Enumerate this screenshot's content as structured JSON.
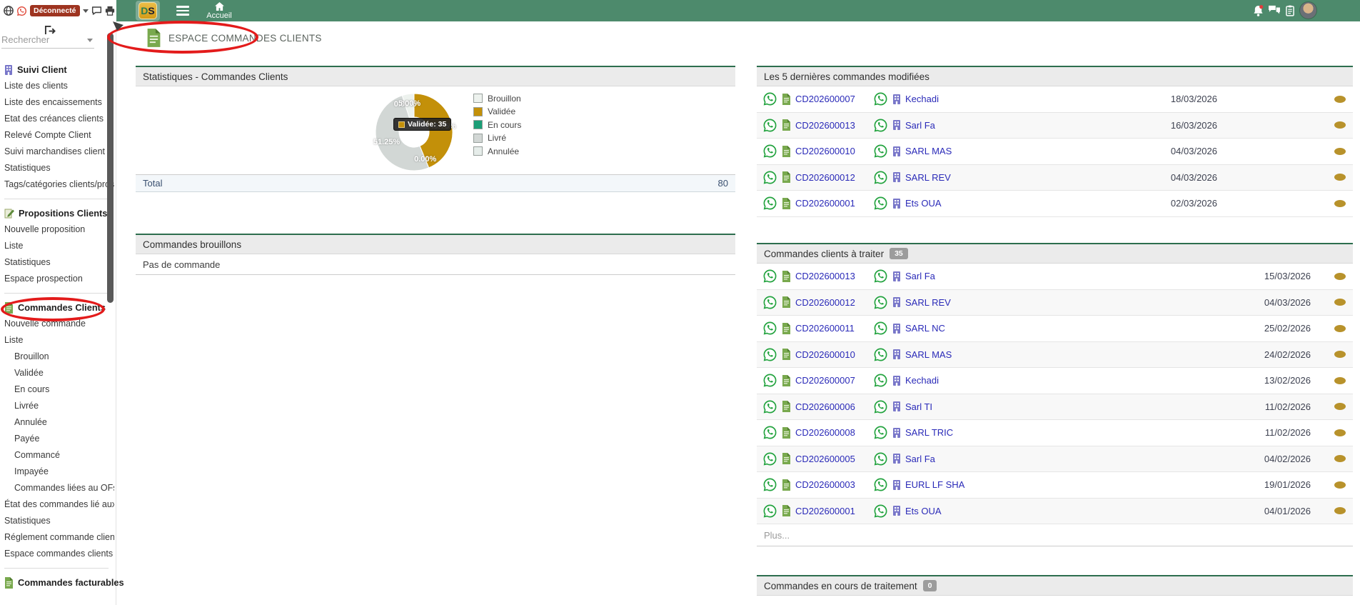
{
  "topbar": {
    "logo_text_d": "D",
    "logo_text_s": "S",
    "accueil_label": "Accueil",
    "right_icons": [
      "bell-icon",
      "chat-bubbles-icon",
      "clipboard-icon",
      "avatar"
    ]
  },
  "quickbar": {
    "icons": [
      "globe-icon",
      "whatsapp-icon",
      "comment-icon",
      "printer-icon",
      "help-icon"
    ],
    "status_label": "Déconnecté"
  },
  "sidebar": {
    "search_placeholder": "Rechercher",
    "sections": [
      {
        "title": "Suivi Client",
        "icon": "building-icon",
        "items": [
          {
            "label": "Liste des clients"
          },
          {
            "label": "Liste des encaissements"
          },
          {
            "label": "Etat des créances clients"
          },
          {
            "label": "Relevé Compte Client"
          },
          {
            "label": "Suivi marchandises client"
          },
          {
            "label": "Statistiques"
          },
          {
            "label": "Tags/catégories clients/prosp."
          }
        ]
      },
      {
        "title": "Propositions Clients",
        "icon": "proposal-icon",
        "items": [
          {
            "label": "Nouvelle proposition"
          },
          {
            "label": "Liste"
          },
          {
            "label": "Statistiques"
          },
          {
            "label": "Espace prospection"
          }
        ]
      },
      {
        "title": "Commandes Clients",
        "icon": "order-doc-icon",
        "highlighted": true,
        "items": [
          {
            "label": "Nouvelle commande"
          },
          {
            "label": "Liste"
          },
          {
            "label": "Brouillon",
            "indent": true
          },
          {
            "label": "Validée",
            "indent": true
          },
          {
            "label": "En cours",
            "indent": true
          },
          {
            "label": "Livrée",
            "indent": true
          },
          {
            "label": "Annulée",
            "indent": true
          },
          {
            "label": "Payée",
            "indent": true
          },
          {
            "label": "Commancé",
            "indent": true
          },
          {
            "label": "Impayée",
            "indent": true
          },
          {
            "label": "Commandes liées au OFs",
            "indent": true
          },
          {
            "label": "État des commandes lié aux ..."
          },
          {
            "label": "Statistiques"
          },
          {
            "label": "Réglement commande client"
          },
          {
            "label": "Espace commandes clients"
          }
        ]
      },
      {
        "title": "Commandes facturables",
        "icon": "order-doc-icon",
        "items": []
      }
    ]
  },
  "page": {
    "title": "ESPACE COMMANDES CLIENTS"
  },
  "stats_panel": {
    "title": "Statistiques - Commandes Clients",
    "total_label": "Total",
    "total_value": "80"
  },
  "chart_data": {
    "type": "pie",
    "title": "Statistiques - Commandes Clients",
    "labels": [
      "Brouillon",
      "Validée",
      "En cours",
      "Livré",
      "Annulée"
    ],
    "values_pct": [
      5.0,
      43.75,
      0.0,
      51.25,
      0.0
    ],
    "counts": {
      "Validée": 35
    },
    "total": 80,
    "colors": [
      "#edf2ee",
      "#c39009",
      "#1b9e77",
      "#d2d7d5",
      "#e6edea"
    ],
    "draw_order": [
      1,
      2,
      3,
      4,
      0
    ],
    "legend_position": "right",
    "tooltip_text": "Validée: 35",
    "donut_hole": true
  },
  "drafts_panel": {
    "title": "Commandes brouillons",
    "empty_text": "Pas de commande"
  },
  "recent_panel": {
    "title": "Les 5 dernières commandes modifiées",
    "rows": [
      {
        "ref": "CD202600007",
        "client": "Kechadi",
        "date": "18/03/2026"
      },
      {
        "ref": "CD202600013",
        "client": "Sarl Fa",
        "date": "16/03/2026"
      },
      {
        "ref": "CD202600010",
        "client": "SARL MAS",
        "date": "04/03/2026"
      },
      {
        "ref": "CD202600012",
        "client": "SARL REV",
        "date": "04/03/2026"
      },
      {
        "ref": "CD202600001",
        "client": "Ets OUA",
        "date": "02/03/2026"
      }
    ]
  },
  "to_process_panel": {
    "title": "Commandes clients à traiter",
    "count": "35",
    "more_label": "Plus...",
    "rows": [
      {
        "ref": "CD202600013",
        "client": "Sarl Fa",
        "date": "15/03/2026"
      },
      {
        "ref": "CD202600012",
        "client": "SARL REV",
        "date": "04/03/2026"
      },
      {
        "ref": "CD202600011",
        "client": "SARL NC",
        "date": "25/02/2026"
      },
      {
        "ref": "CD202600010",
        "client": "SARL MAS",
        "date": "24/02/2026"
      },
      {
        "ref": "CD202600007",
        "client": "Kechadi",
        "date": "13/02/2026"
      },
      {
        "ref": "CD202600006",
        "client": "Sarl TI",
        "date": "11/02/2026"
      },
      {
        "ref": "CD202600008",
        "client": "SARL TRIC",
        "date": "11/02/2026"
      },
      {
        "ref": "CD202600005",
        "client": "Sarl Fa",
        "date": "04/02/2026"
      },
      {
        "ref": "CD202600003",
        "client": "EURL LF SHA",
        "date": "19/01/2026"
      },
      {
        "ref": "CD202600001",
        "client": "Ets OUA",
        "date": "04/01/2026"
      }
    ]
  },
  "processing_panel": {
    "title": "Commandes en cours de traitement",
    "count": "0"
  },
  "colors": {
    "topbar_green": "#4d8a6c",
    "panel_border_green": "#2d6e4e",
    "link_blue": "#2a2ab8",
    "status_gold": "#b8922b",
    "annotation_red": "#e31b1b",
    "badge_maroon": "#9e3420"
  }
}
